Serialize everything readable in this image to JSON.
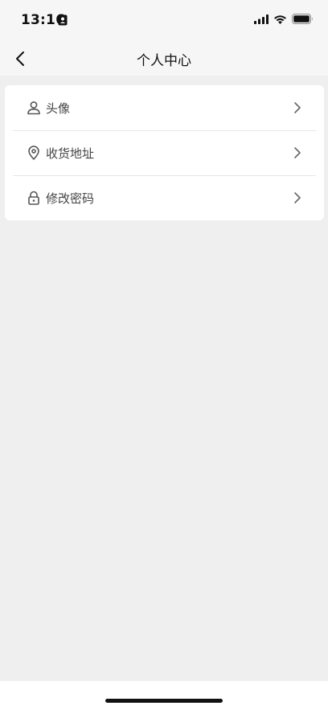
{
  "status_bar": {
    "time": "13:16",
    "icons": [
      "contact-card-icon",
      "signal-icon",
      "wifi-icon",
      "battery-icon"
    ]
  },
  "nav": {
    "title": "个人中心",
    "back_icon": "chevron-left-icon"
  },
  "menu": {
    "items": [
      {
        "label": "头像",
        "icon": "user-icon"
      },
      {
        "label": "收货地址",
        "icon": "location-pin-icon"
      },
      {
        "label": "修改密码",
        "icon": "lock-icon"
      }
    ]
  },
  "colors": {
    "background": "#efefef",
    "card": "#ffffff",
    "text": "#444444",
    "title": "#111111",
    "divider": "#e6e6e6"
  }
}
